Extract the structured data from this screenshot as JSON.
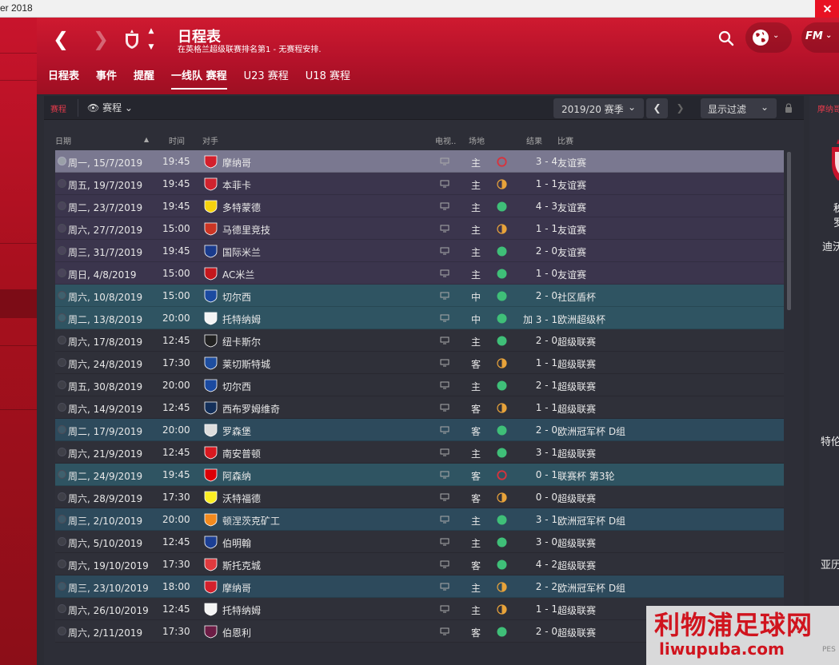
{
  "window": {
    "title": "er 2018"
  },
  "header": {
    "title": "日程表",
    "subtitle": "在英格兰超级联赛排名第1 - 无赛程安排.",
    "fm_label": "FM"
  },
  "tabs": [
    {
      "label": "日程表"
    },
    {
      "label": "事件"
    },
    {
      "label": "提醒"
    },
    {
      "label": "一线队 赛程"
    },
    {
      "label": "U23 赛程"
    },
    {
      "label": "U18 赛程"
    }
  ],
  "toolbar": {
    "section_label": "赛程",
    "view_label": "赛程",
    "season": "2019/20 赛季",
    "filter": "显示过滤"
  },
  "columns": {
    "date": "日期",
    "time": "时间",
    "opponent": "对手",
    "tv": "电视..",
    "venue": "场地",
    "result": "结果",
    "competition": "比赛"
  },
  "fixtures": [
    {
      "date": "周一, 15/7/2019",
      "time": "19:45",
      "opponent": "摩纳哥",
      "venue": "主",
      "result": "loss",
      "score": "3 - 4",
      "competition": "友谊赛",
      "type": "friendly",
      "crest": "#d3202c"
    },
    {
      "date": "周五, 19/7/2019",
      "time": "19:45",
      "opponent": "本菲卡",
      "venue": "主",
      "result": "draw",
      "score": "1 - 1",
      "competition": "友谊赛",
      "type": "friendly",
      "crest": "#d0232e"
    },
    {
      "date": "周二, 23/7/2019",
      "time": "19:45",
      "opponent": "多特蒙德",
      "venue": "主",
      "result": "win",
      "score": "4 - 3",
      "competition": "友谊赛",
      "type": "friendly",
      "crest": "#f5d20e"
    },
    {
      "date": "周六, 27/7/2019",
      "time": "15:00",
      "opponent": "马德里竞技",
      "venue": "主",
      "result": "draw",
      "score": "1 - 1",
      "competition": "友谊赛",
      "type": "friendly",
      "crest": "#cb3524"
    },
    {
      "date": "周三, 31/7/2019",
      "time": "19:45",
      "opponent": "国际米兰",
      "venue": "主",
      "result": "win",
      "score": "2 - 0",
      "competition": "友谊赛",
      "type": "friendly",
      "crest": "#1a3b8c"
    },
    {
      "date": "周日, 4/8/2019",
      "time": "15:00",
      "opponent": "AC米兰",
      "venue": "主",
      "result": "win",
      "score": "1 - 0",
      "competition": "友谊赛",
      "type": "friendly",
      "crest": "#c4171d"
    },
    {
      "date": "周六, 10/8/2019",
      "time": "15:00",
      "opponent": "切尔西",
      "venue": "中",
      "result": "win",
      "score": "2 - 0",
      "competition": "社区盾杯",
      "type": "cup",
      "crest": "#1b4aa0"
    },
    {
      "date": "周二, 13/8/2019",
      "time": "20:00",
      "opponent": "托特纳姆",
      "venue": "中",
      "result": "win",
      "score": "加 3 - 1",
      "competition": "欧洲超级杯",
      "type": "cup",
      "crest": "#f4f4f4"
    },
    {
      "date": "周六, 17/8/2019",
      "time": "12:45",
      "opponent": "纽卡斯尔",
      "venue": "主",
      "result": "win",
      "score": "2 - 0",
      "competition": "超级联赛",
      "type": "league",
      "crest": "#222222"
    },
    {
      "date": "周六, 24/8/2019",
      "time": "17:30",
      "opponent": "莱切斯特城",
      "venue": "客",
      "result": "draw",
      "score": "1 - 1",
      "competition": "超级联赛",
      "type": "league",
      "crest": "#1e4ea0"
    },
    {
      "date": "周五, 30/8/2019",
      "time": "20:00",
      "opponent": "切尔西",
      "venue": "主",
      "result": "win",
      "score": "2 - 1",
      "competition": "超级联赛",
      "type": "league",
      "crest": "#1b4aa0"
    },
    {
      "date": "周六, 14/9/2019",
      "time": "12:45",
      "opponent": "西布罗姆维奇",
      "venue": "客",
      "result": "draw",
      "score": "1 - 1",
      "competition": "超级联赛",
      "type": "league",
      "crest": "#14305a"
    },
    {
      "date": "周二, 17/9/2019",
      "time": "20:00",
      "opponent": "罗森堡",
      "venue": "客",
      "result": "win",
      "score": "2 - 0",
      "competition": "欧洲冠军杯 D组",
      "type": "euro",
      "crest": "#dddddd"
    },
    {
      "date": "周六, 21/9/2019",
      "time": "12:45",
      "opponent": "南安普顿",
      "venue": "主",
      "result": "win",
      "score": "3 - 1",
      "competition": "超级联赛",
      "type": "league",
      "crest": "#d71920"
    },
    {
      "date": "周二, 24/9/2019",
      "time": "19:45",
      "opponent": "阿森纳",
      "venue": "客",
      "result": "loss",
      "score": "0 - 1",
      "competition": "联赛杯 第3轮",
      "type": "cup",
      "crest": "#db0007"
    },
    {
      "date": "周六, 28/9/2019",
      "time": "17:30",
      "opponent": "沃特福德",
      "venue": "客",
      "result": "draw",
      "score": "0 - 0",
      "competition": "超级联赛",
      "type": "league",
      "crest": "#fbee23"
    },
    {
      "date": "周三, 2/10/2019",
      "time": "20:00",
      "opponent": "顿涅茨克矿工",
      "venue": "主",
      "result": "win",
      "score": "3 - 1",
      "competition": "欧洲冠军杯 D组",
      "type": "euro",
      "crest": "#f28a1e"
    },
    {
      "date": "周六, 5/10/2019",
      "time": "12:45",
      "opponent": "伯明翰",
      "venue": "主",
      "result": "win",
      "score": "3 - 0",
      "competition": "超级联赛",
      "type": "league",
      "crest": "#1c3f94"
    },
    {
      "date": "周六, 19/10/2019",
      "time": "17:30",
      "opponent": "斯托克城",
      "venue": "客",
      "result": "win",
      "score": "4 - 2",
      "competition": "超级联赛",
      "type": "league",
      "crest": "#e03a3e"
    },
    {
      "date": "周三, 23/10/2019",
      "time": "18:00",
      "opponent": "摩纳哥",
      "venue": "主",
      "result": "draw",
      "score": "2 - 2",
      "competition": "欧洲冠军杯 D组",
      "type": "euro",
      "crest": "#d3202c"
    },
    {
      "date": "周六, 26/10/2019",
      "time": "12:45",
      "opponent": "托特纳姆",
      "venue": "主",
      "result": "draw",
      "score": "1 - 1",
      "competition": "超级联赛",
      "type": "league",
      "crest": "#f4f4f4"
    },
    {
      "date": "周六, 2/11/2019",
      "time": "17:30",
      "opponent": "伯恩利",
      "venue": "客",
      "result": "win",
      "score": "2 - 0",
      "competition": "超级联赛",
      "type": "league",
      "crest": "#6c1d45"
    }
  ],
  "result_colors": {
    "win": "#3fbf78",
    "draw": "#e8a33a",
    "loss": "#d9323c"
  },
  "side_panel": {
    "title": "摩纳哥",
    "lines": [
      "秭",
      "罗",
      "迪沃",
      "特伦",
      "亚历"
    ]
  },
  "watermark": {
    "line1": "利物浦足球网",
    "line2": "liwupuba.com",
    "stamp": "PES"
  },
  "colors": {
    "accent": "#c8142c",
    "header_red": "#b5122a"
  }
}
